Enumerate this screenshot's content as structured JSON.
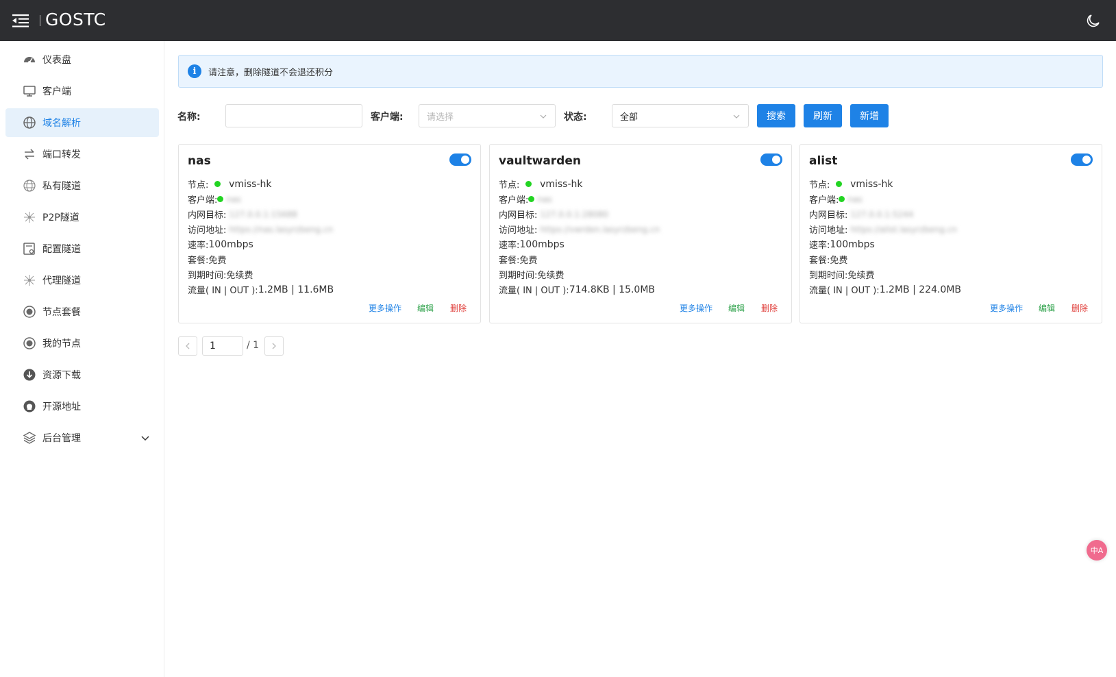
{
  "app": {
    "title": "GOSTC",
    "menu_icon": "menu-fold-icon",
    "theme_icon": "moon-icon"
  },
  "sidebar": {
    "items": [
      {
        "label": "仪表盘",
        "icon": "dashboard-icon"
      },
      {
        "label": "客户端",
        "icon": "monitor-icon"
      },
      {
        "label": "域名解析",
        "icon": "globe-icon",
        "active": true
      },
      {
        "label": "端口转发",
        "icon": "swap-icon"
      },
      {
        "label": "私有隧道",
        "icon": "globe-grid-icon"
      },
      {
        "label": "P2P隧道",
        "icon": "network-icon"
      },
      {
        "label": "配置隧道",
        "icon": "config-icon"
      },
      {
        "label": "代理隧道",
        "icon": "network-icon"
      },
      {
        "label": "节点套餐",
        "icon": "circle-dot-icon"
      },
      {
        "label": "我的节点",
        "icon": "circle-dot-icon"
      },
      {
        "label": "资源下载",
        "icon": "download-icon"
      },
      {
        "label": "开源地址",
        "icon": "github-icon"
      },
      {
        "label": "后台管理",
        "icon": "layers-icon",
        "expandable": true
      }
    ]
  },
  "notice": {
    "text": "请注意，删除隧道不会退还积分"
  },
  "filters": {
    "name_label": "名称:",
    "name_value": "",
    "client_label": "客户端:",
    "client_placeholder": "请选择",
    "status_label": "状态:",
    "status_value": "全部",
    "search_label": "搜索",
    "refresh_label": "刷新",
    "add_label": "新增"
  },
  "card_labels": {
    "node": "节点:",
    "client": "客户端:",
    "target": "内网目标:",
    "address": "访问地址:",
    "rate": "速率:",
    "plan": "套餐:",
    "expire": "到期时间:",
    "traffic": "流量( IN | OUT ):",
    "more": "更多操作",
    "edit": "编辑",
    "delete": "删除"
  },
  "tunnels": [
    {
      "name": "nas",
      "enabled": true,
      "node": "vmiss-hk",
      "client": "nas",
      "target": "127.0.0.1:15688",
      "address": "https://nas.lasyrzbeng.cn",
      "rate": "100mbps",
      "plan": "免费",
      "expire": "免续费",
      "traffic": "1.2MB | 11.6MB"
    },
    {
      "name": "vaultwarden",
      "enabled": true,
      "node": "vmiss-hk",
      "client": "nas",
      "target": "127.0.0.1:28080",
      "address": "https://vwrden.lasyrzbeng.cn",
      "rate": "100mbps",
      "plan": "免费",
      "expire": "免续费",
      "traffic": "714.8KB | 15.0MB"
    },
    {
      "name": "alist",
      "enabled": true,
      "node": "vmiss-hk",
      "client": "nas",
      "target": "127.0.0.1:5244",
      "address": "https://alist.lasyrzbeng.cn",
      "rate": "100mbps",
      "plan": "免费",
      "expire": "免续费",
      "traffic": "1.2MB | 224.0MB"
    }
  ],
  "pagination": {
    "current": "1",
    "total": "/ 1",
    "prev_icon": "chevron-left-icon",
    "next_icon": "chevron-right-icon"
  },
  "floating": {
    "translate_label": "中A",
    "icon": "translate-icon"
  },
  "colors": {
    "header_bg": "#2d2e31",
    "primary": "#1e82e6",
    "online": "#22d422",
    "edit": "#2fa24b",
    "delete": "#e0403c"
  }
}
